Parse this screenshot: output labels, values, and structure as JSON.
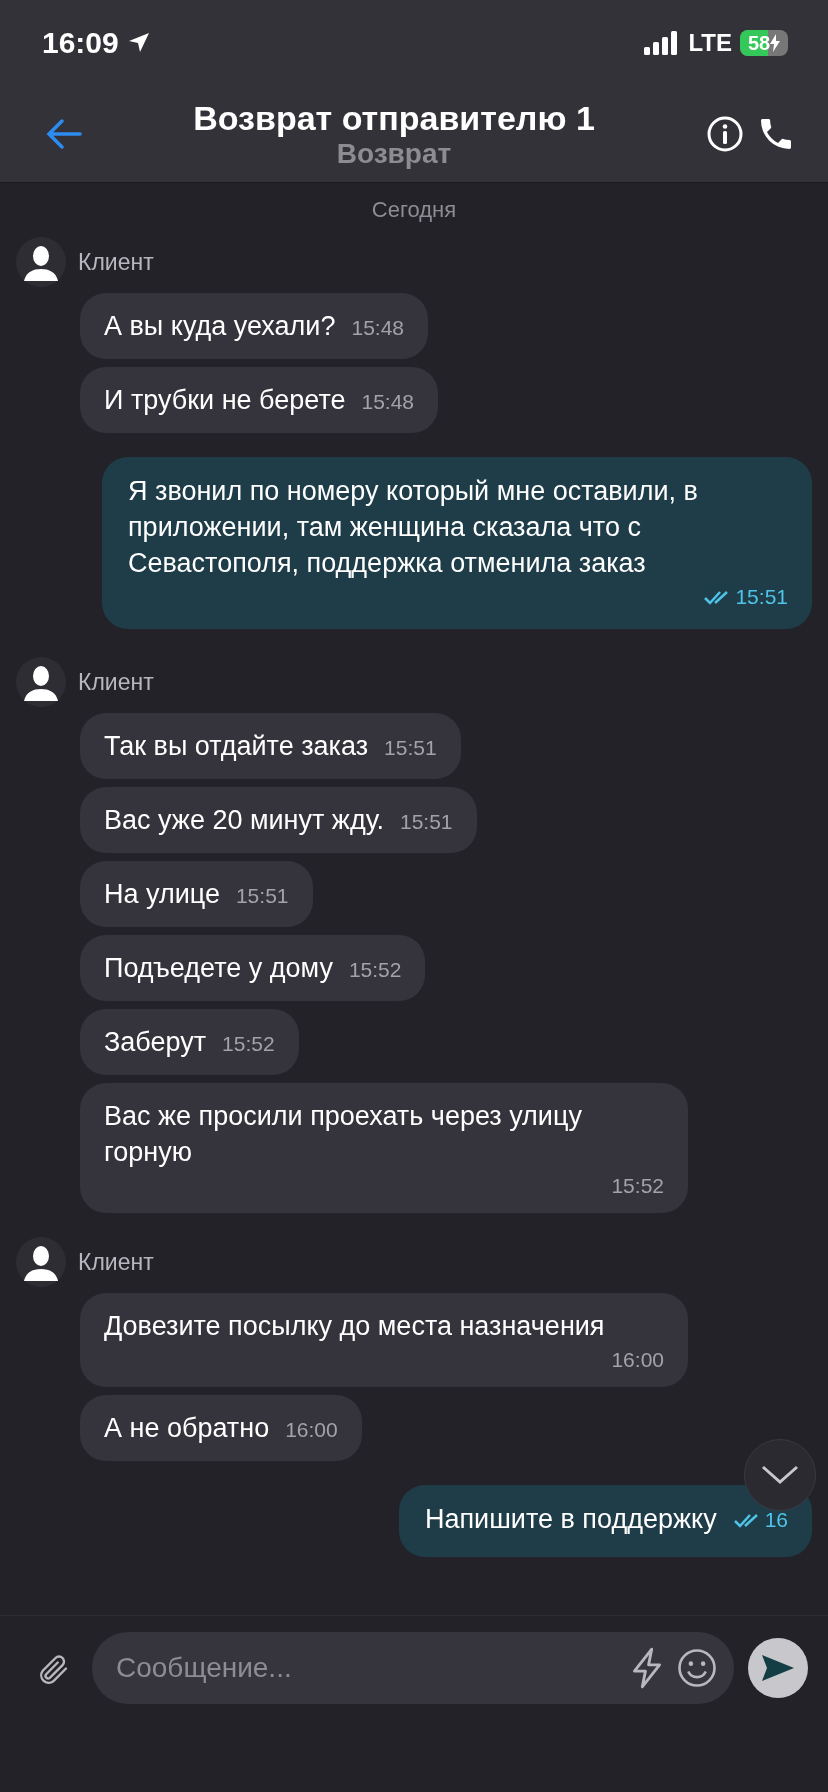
{
  "status_bar": {
    "time": "16:09",
    "network": "LTE",
    "battery": "58",
    "charging": true
  },
  "header": {
    "title": "Возврат отправителю 1",
    "subtitle": "Возврат"
  },
  "date_divider": "Сегодня",
  "groups": [
    {
      "kind": "incoming",
      "sender": "Клиент",
      "messages": [
        {
          "text": "А вы куда уехали?",
          "time": "15:48"
        },
        {
          "text": "И трубки не берете",
          "time": "15:48"
        }
      ]
    },
    {
      "kind": "outgoing",
      "messages": [
        {
          "text": "Я звонил по номеру который мне оставили, в приложении, там женщина сказала что с Севастополя, поддержка отменила заказ",
          "time": "15:51",
          "read": true
        }
      ]
    },
    {
      "kind": "incoming",
      "sender": "Клиент",
      "messages": [
        {
          "text": "Так вы отдайте заказ",
          "time": "15:51"
        },
        {
          "text": "Вас уже 20 минут жду.",
          "time": "15:51"
        },
        {
          "text": "На улице",
          "time": "15:51"
        },
        {
          "text": "Подъедете у дому",
          "time": "15:52"
        },
        {
          "text": "Заберут",
          "time": "15:52"
        },
        {
          "text": "Вас же просили проехать через улицу горную",
          "time": "15:52"
        }
      ]
    },
    {
      "kind": "incoming",
      "sender": "Клиент",
      "messages": [
        {
          "text": "Довезите посылку до места назначения",
          "time": "16:00"
        },
        {
          "text": "А не обратно",
          "time": "16:00"
        }
      ]
    },
    {
      "kind": "outgoing",
      "messages": [
        {
          "text": "Напишите в поддержку",
          "time": "16",
          "read": true
        }
      ]
    }
  ],
  "composer": {
    "placeholder": "Сообщение..."
  }
}
